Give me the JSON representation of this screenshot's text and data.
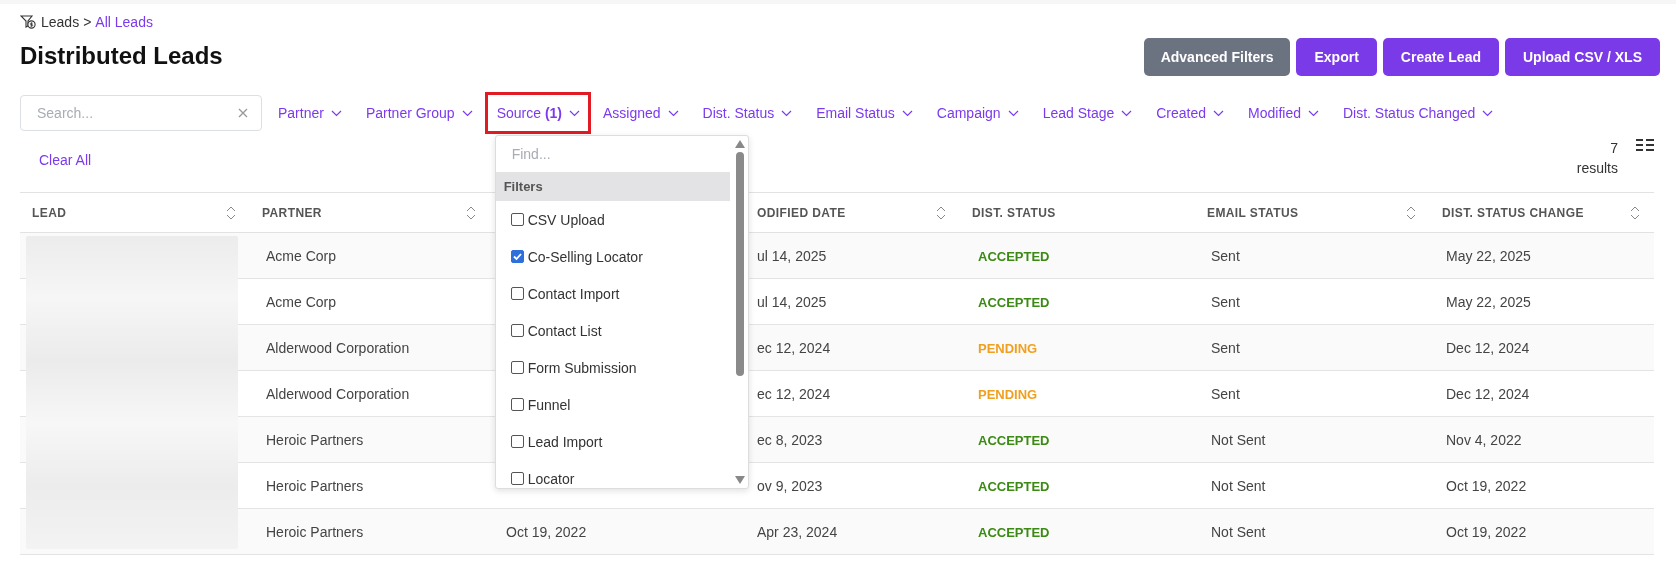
{
  "breadcrumb": {
    "root": "Leads",
    "separator": ">",
    "current": "All Leads"
  },
  "title": "Distributed Leads",
  "buttons": [
    {
      "label": "Advanced Filters",
      "kind": "secondary"
    },
    {
      "label": "Export",
      "kind": "primary"
    },
    {
      "label": "Create Lead",
      "kind": "primary"
    },
    {
      "label": "Upload CSV / XLS",
      "kind": "primary"
    }
  ],
  "search": {
    "placeholder": "Search..."
  },
  "filters": [
    {
      "label": "Partner",
      "selected": false
    },
    {
      "label": "Partner Group",
      "selected": false
    },
    {
      "label": "Source **(1)**",
      "selected": true
    },
    {
      "label": "Assigned",
      "selected": false
    },
    {
      "label": "Dist. Status",
      "selected": false
    },
    {
      "label": "Email Status",
      "selected": false
    },
    {
      "label": "Campaign",
      "selected": false
    },
    {
      "label": "Lead Stage",
      "selected": false
    },
    {
      "label": "Created",
      "selected": false
    },
    {
      "label": "Modified",
      "selected": false
    },
    {
      "label": "Dist. Status Changed",
      "selected": false
    }
  ],
  "clear_all": "Clear All",
  "results": {
    "count": "7",
    "label": "results"
  },
  "dropdown": {
    "placeholder": "Find...",
    "group": "Filters",
    "options": [
      {
        "label": "CSV Upload",
        "checked": false
      },
      {
        "label": "Co-Selling Locator",
        "checked": true
      },
      {
        "label": "Contact Import",
        "checked": false
      },
      {
        "label": "Contact List",
        "checked": false
      },
      {
        "label": "Form Submission",
        "checked": false
      },
      {
        "label": "Funnel",
        "checked": false
      },
      {
        "label": "Lead Import",
        "checked": false
      },
      {
        "label": "Locator",
        "checked": false
      }
    ]
  },
  "table": {
    "columns": [
      {
        "label": "LEAD",
        "sortable": true
      },
      {
        "label": "PARTNER",
        "sortable": true
      },
      {
        "label": "ODIFIED DATE",
        "sortable": true
      },
      {
        "label": "DIST. STATUS",
        "sortable": false
      },
      {
        "label": "EMAIL STATUS",
        "sortable": true
      },
      {
        "label": "DIST. STATUS CHANGE",
        "sortable": true
      }
    ],
    "rows": [
      {
        "partner": "Acme Corp",
        "modified_date": "ul 14, 2025",
        "dist_status": {
          "label": "ACCEPTED",
          "color": "#3b8a13"
        },
        "email_status": "Sent",
        "dist_status_change": "May 22, 2025"
      },
      {
        "partner": "Acme Corp",
        "modified_date": "ul 14, 2025",
        "dist_status": {
          "label": "ACCEPTED",
          "color": "#3b8a13"
        },
        "email_status": "Sent",
        "dist_status_change": "May 22, 2025"
      },
      {
        "partner": "Alderwood Corporation",
        "modified_date": "ec 12, 2024",
        "dist_status": {
          "label": "PENDING",
          "color": "#f0a020"
        },
        "email_status": "Sent",
        "dist_status_change": "Dec 12, 2024"
      },
      {
        "partner": "Alderwood Corporation",
        "modified_date": "ec 12, 2024",
        "dist_status": {
          "label": "PENDING",
          "color": "#f0a020"
        },
        "email_status": "Sent",
        "dist_status_change": "Dec 12, 2024"
      },
      {
        "partner": "Heroic Partners",
        "modified_date": "ec 8, 2023",
        "dist_status": {
          "label": "ACCEPTED",
          "color": "#3b8a13"
        },
        "email_status": "Not Sent",
        "dist_status_change": "Nov 4, 2022"
      },
      {
        "partner": "Heroic Partners",
        "modified_date": "ov 9, 2023",
        "dist_status": {
          "label": "ACCEPTED",
          "color": "#3b8a13"
        },
        "email_status": "Not Sent",
        "dist_status_change": "Oct 19, 2022"
      },
      {
        "partner": "Heroic Partners",
        "created_date": "Oct 19, 2022",
        "modified_date": "Apr 23, 2024",
        "dist_status": {
          "label": "ACCEPTED",
          "color": "#3b8a13"
        },
        "email_status": "Not Sent",
        "dist_status_change": "Oct 19, 2022"
      }
    ]
  }
}
